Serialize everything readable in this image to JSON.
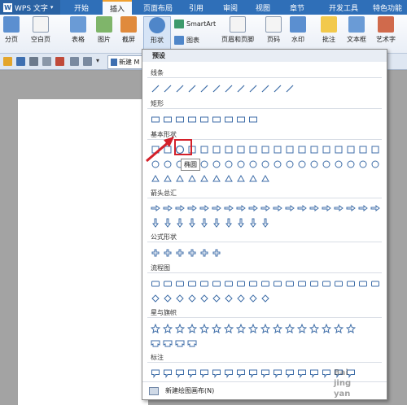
{
  "app": {
    "name": "WPS 文字",
    "logo": "W"
  },
  "tabs": [
    {
      "label": "开始"
    },
    {
      "label": "插入"
    },
    {
      "label": "页面布局"
    },
    {
      "label": "引用"
    },
    {
      "label": "审阅"
    },
    {
      "label": "视图"
    },
    {
      "label": "章节"
    },
    {
      "label": "开发工具"
    },
    {
      "label": "特色功能"
    }
  ],
  "ribbon": {
    "page_break": "分页",
    "blank_page": "空白页",
    "table": "表格",
    "picture": "图片",
    "screenshot": "截屏",
    "shapes": "形状",
    "smartart": "SmartArt",
    "chart": "图表",
    "header_footer": "页眉和页脚",
    "page_num": "页码",
    "watermark": "水印",
    "comment": "批注",
    "textbox": "文本框",
    "wordart": "艺术字"
  },
  "quickbar": {
    "doc_tab": "新建 M"
  },
  "menu": {
    "preset": "预设",
    "categories": [
      "线条",
      "矩形",
      "基本形状",
      "箭头总汇",
      "公式形状",
      "流程图",
      "星与旗帜",
      "标注"
    ],
    "tooltip": "椭圆",
    "new_canvas": "新建绘图画布(N)"
  },
  "watermark_text": [
    "Bai",
    "jing",
    "yan"
  ],
  "colors": {
    "accent": "#2f6fb8",
    "highlight": "#d4202a"
  }
}
